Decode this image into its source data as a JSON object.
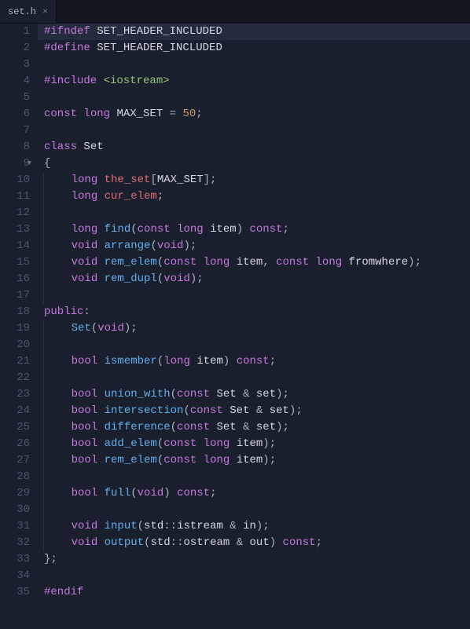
{
  "tab": {
    "filename": "set.h",
    "close": "×"
  },
  "lines": [
    {
      "n": "1",
      "fold": "",
      "hl": true,
      "tokens": [
        {
          "t": "#ifndef",
          "c": "kw"
        },
        {
          "t": " ",
          "c": ""
        },
        {
          "t": "SET_HEADER_INCLUDED",
          "c": "white"
        }
      ]
    },
    {
      "n": "2",
      "fold": "",
      "tokens": [
        {
          "t": "#define",
          "c": "kw"
        },
        {
          "t": " ",
          "c": ""
        },
        {
          "t": "SET_HEADER_INCLUDED",
          "c": "white"
        }
      ]
    },
    {
      "n": "3",
      "fold": "",
      "tokens": []
    },
    {
      "n": "4",
      "fold": "",
      "tokens": [
        {
          "t": "#include",
          "c": "kw"
        },
        {
          "t": " ",
          "c": ""
        },
        {
          "t": "<iostream>",
          "c": "str"
        }
      ]
    },
    {
      "n": "5",
      "fold": "",
      "tokens": []
    },
    {
      "n": "6",
      "fold": "",
      "tokens": [
        {
          "t": "const",
          "c": "kw"
        },
        {
          "t": " ",
          "c": ""
        },
        {
          "t": "long",
          "c": "type"
        },
        {
          "t": " ",
          "c": ""
        },
        {
          "t": "MAX_SET",
          "c": "white"
        },
        {
          "t": " = ",
          "c": "grey"
        },
        {
          "t": "50",
          "c": "num"
        },
        {
          "t": ";",
          "c": "grey"
        }
      ]
    },
    {
      "n": "7",
      "fold": "",
      "tokens": []
    },
    {
      "n": "8",
      "fold": "",
      "tokens": [
        {
          "t": "class",
          "c": "kw"
        },
        {
          "t": " ",
          "c": ""
        },
        {
          "t": "Set",
          "c": "white"
        }
      ]
    },
    {
      "n": "9",
      "fold": "▼",
      "tokens": [
        {
          "t": "{",
          "c": "grey"
        }
      ]
    },
    {
      "n": "10",
      "fold": "",
      "indent": 1,
      "tokens": [
        {
          "t": "    ",
          "c": ""
        },
        {
          "t": "long",
          "c": "type"
        },
        {
          "t": " ",
          "c": ""
        },
        {
          "t": "the_set",
          "c": "ident"
        },
        {
          "t": "[",
          "c": "grey"
        },
        {
          "t": "MAX_SET",
          "c": "white"
        },
        {
          "t": "];",
          "c": "grey"
        }
      ]
    },
    {
      "n": "11",
      "fold": "",
      "indent": 1,
      "tokens": [
        {
          "t": "    ",
          "c": ""
        },
        {
          "t": "long",
          "c": "type"
        },
        {
          "t": " ",
          "c": ""
        },
        {
          "t": "cur_elem",
          "c": "ident"
        },
        {
          "t": ";",
          "c": "grey"
        }
      ]
    },
    {
      "n": "12",
      "fold": "",
      "indent": 1,
      "tokens": []
    },
    {
      "n": "13",
      "fold": "",
      "indent": 1,
      "tokens": [
        {
          "t": "    ",
          "c": ""
        },
        {
          "t": "long",
          "c": "type"
        },
        {
          "t": " ",
          "c": ""
        },
        {
          "t": "find",
          "c": "func"
        },
        {
          "t": "(",
          "c": "grey"
        },
        {
          "t": "const",
          "c": "kw"
        },
        {
          "t": " ",
          "c": ""
        },
        {
          "t": "long",
          "c": "type"
        },
        {
          "t": " ",
          "c": ""
        },
        {
          "t": "item",
          "c": "white"
        },
        {
          "t": ") ",
          "c": "grey"
        },
        {
          "t": "const",
          "c": "kw"
        },
        {
          "t": ";",
          "c": "grey"
        }
      ]
    },
    {
      "n": "14",
      "fold": "",
      "indent": 1,
      "tokens": [
        {
          "t": "    ",
          "c": ""
        },
        {
          "t": "void",
          "c": "type"
        },
        {
          "t": " ",
          "c": ""
        },
        {
          "t": "arrange",
          "c": "func"
        },
        {
          "t": "(",
          "c": "grey"
        },
        {
          "t": "void",
          "c": "type"
        },
        {
          "t": ");",
          "c": "grey"
        }
      ]
    },
    {
      "n": "15",
      "fold": "",
      "indent": 1,
      "tokens": [
        {
          "t": "    ",
          "c": ""
        },
        {
          "t": "void",
          "c": "type"
        },
        {
          "t": " ",
          "c": ""
        },
        {
          "t": "rem_elem",
          "c": "func"
        },
        {
          "t": "(",
          "c": "grey"
        },
        {
          "t": "const",
          "c": "kw"
        },
        {
          "t": " ",
          "c": ""
        },
        {
          "t": "long",
          "c": "type"
        },
        {
          "t": " ",
          "c": ""
        },
        {
          "t": "item",
          "c": "white"
        },
        {
          "t": ", ",
          "c": "grey"
        },
        {
          "t": "const",
          "c": "kw"
        },
        {
          "t": " ",
          "c": ""
        },
        {
          "t": "long",
          "c": "type"
        },
        {
          "t": " ",
          "c": ""
        },
        {
          "t": "fromwhere",
          "c": "white"
        },
        {
          "t": ");",
          "c": "grey"
        }
      ]
    },
    {
      "n": "16",
      "fold": "",
      "indent": 1,
      "tokens": [
        {
          "t": "    ",
          "c": ""
        },
        {
          "t": "void",
          "c": "type"
        },
        {
          "t": " ",
          "c": ""
        },
        {
          "t": "rem_dupl",
          "c": "func"
        },
        {
          "t": "(",
          "c": "grey"
        },
        {
          "t": "void",
          "c": "type"
        },
        {
          "t": ");",
          "c": "grey"
        }
      ]
    },
    {
      "n": "17",
      "fold": "",
      "indent": 1,
      "tokens": []
    },
    {
      "n": "18",
      "fold": "",
      "tokens": [
        {
          "t": "public",
          "c": "kw"
        },
        {
          "t": ":",
          "c": "grey"
        }
      ]
    },
    {
      "n": "19",
      "fold": "",
      "indent": 1,
      "tokens": [
        {
          "t": "    ",
          "c": ""
        },
        {
          "t": "Set",
          "c": "func"
        },
        {
          "t": "(",
          "c": "grey"
        },
        {
          "t": "void",
          "c": "type"
        },
        {
          "t": ");",
          "c": "grey"
        }
      ]
    },
    {
      "n": "20",
      "fold": "",
      "indent": 1,
      "tokens": []
    },
    {
      "n": "21",
      "fold": "",
      "indent": 1,
      "tokens": [
        {
          "t": "    ",
          "c": ""
        },
        {
          "t": "bool",
          "c": "type"
        },
        {
          "t": " ",
          "c": ""
        },
        {
          "t": "ismember",
          "c": "func"
        },
        {
          "t": "(",
          "c": "grey"
        },
        {
          "t": "long",
          "c": "type"
        },
        {
          "t": " ",
          "c": ""
        },
        {
          "t": "item",
          "c": "white"
        },
        {
          "t": ") ",
          "c": "grey"
        },
        {
          "t": "const",
          "c": "kw"
        },
        {
          "t": ";",
          "c": "grey"
        }
      ]
    },
    {
      "n": "22",
      "fold": "",
      "indent": 1,
      "tokens": []
    },
    {
      "n": "23",
      "fold": "",
      "indent": 1,
      "tokens": [
        {
          "t": "    ",
          "c": ""
        },
        {
          "t": "bool",
          "c": "type"
        },
        {
          "t": " ",
          "c": ""
        },
        {
          "t": "union_with",
          "c": "func"
        },
        {
          "t": "(",
          "c": "grey"
        },
        {
          "t": "const",
          "c": "kw"
        },
        {
          "t": " ",
          "c": ""
        },
        {
          "t": "Set",
          "c": "white"
        },
        {
          "t": " & ",
          "c": "grey"
        },
        {
          "t": "set",
          "c": "white"
        },
        {
          "t": ");",
          "c": "grey"
        }
      ]
    },
    {
      "n": "24",
      "fold": "",
      "indent": 1,
      "tokens": [
        {
          "t": "    ",
          "c": ""
        },
        {
          "t": "bool",
          "c": "type"
        },
        {
          "t": " ",
          "c": ""
        },
        {
          "t": "intersection",
          "c": "func"
        },
        {
          "t": "(",
          "c": "grey"
        },
        {
          "t": "const",
          "c": "kw"
        },
        {
          "t": " ",
          "c": ""
        },
        {
          "t": "Set",
          "c": "white"
        },
        {
          "t": " & ",
          "c": "grey"
        },
        {
          "t": "set",
          "c": "white"
        },
        {
          "t": ");",
          "c": "grey"
        }
      ]
    },
    {
      "n": "25",
      "fold": "",
      "indent": 1,
      "tokens": [
        {
          "t": "    ",
          "c": ""
        },
        {
          "t": "bool",
          "c": "type"
        },
        {
          "t": " ",
          "c": ""
        },
        {
          "t": "difference",
          "c": "func"
        },
        {
          "t": "(",
          "c": "grey"
        },
        {
          "t": "const",
          "c": "kw"
        },
        {
          "t": " ",
          "c": ""
        },
        {
          "t": "Set",
          "c": "white"
        },
        {
          "t": " & ",
          "c": "grey"
        },
        {
          "t": "set",
          "c": "white"
        },
        {
          "t": ");",
          "c": "grey"
        }
      ]
    },
    {
      "n": "26",
      "fold": "",
      "indent": 1,
      "tokens": [
        {
          "t": "    ",
          "c": ""
        },
        {
          "t": "bool",
          "c": "type"
        },
        {
          "t": " ",
          "c": ""
        },
        {
          "t": "add_elem",
          "c": "func"
        },
        {
          "t": "(",
          "c": "grey"
        },
        {
          "t": "const",
          "c": "kw"
        },
        {
          "t": " ",
          "c": ""
        },
        {
          "t": "long",
          "c": "type"
        },
        {
          "t": " ",
          "c": ""
        },
        {
          "t": "item",
          "c": "white"
        },
        {
          "t": ");",
          "c": "grey"
        }
      ]
    },
    {
      "n": "27",
      "fold": "",
      "indent": 1,
      "tokens": [
        {
          "t": "    ",
          "c": ""
        },
        {
          "t": "bool",
          "c": "type"
        },
        {
          "t": " ",
          "c": ""
        },
        {
          "t": "rem_elem",
          "c": "func"
        },
        {
          "t": "(",
          "c": "grey"
        },
        {
          "t": "const",
          "c": "kw"
        },
        {
          "t": " ",
          "c": ""
        },
        {
          "t": "long",
          "c": "type"
        },
        {
          "t": " ",
          "c": ""
        },
        {
          "t": "item",
          "c": "white"
        },
        {
          "t": ");",
          "c": "grey"
        }
      ]
    },
    {
      "n": "28",
      "fold": "",
      "indent": 1,
      "tokens": []
    },
    {
      "n": "29",
      "fold": "",
      "indent": 1,
      "tokens": [
        {
          "t": "    ",
          "c": ""
        },
        {
          "t": "bool",
          "c": "type"
        },
        {
          "t": " ",
          "c": ""
        },
        {
          "t": "full",
          "c": "func"
        },
        {
          "t": "(",
          "c": "grey"
        },
        {
          "t": "void",
          "c": "type"
        },
        {
          "t": ") ",
          "c": "grey"
        },
        {
          "t": "const",
          "c": "kw"
        },
        {
          "t": ";",
          "c": "grey"
        }
      ]
    },
    {
      "n": "30",
      "fold": "",
      "indent": 1,
      "tokens": []
    },
    {
      "n": "31",
      "fold": "",
      "indent": 1,
      "tokens": [
        {
          "t": "    ",
          "c": ""
        },
        {
          "t": "void",
          "c": "type"
        },
        {
          "t": " ",
          "c": ""
        },
        {
          "t": "input",
          "c": "func"
        },
        {
          "t": "(",
          "c": "grey"
        },
        {
          "t": "std",
          "c": "white"
        },
        {
          "t": "::",
          "c": "grey"
        },
        {
          "t": "istream",
          "c": "white"
        },
        {
          "t": " & ",
          "c": "grey"
        },
        {
          "t": "in",
          "c": "white"
        },
        {
          "t": ");",
          "c": "grey"
        }
      ]
    },
    {
      "n": "32",
      "fold": "",
      "indent": 1,
      "tokens": [
        {
          "t": "    ",
          "c": ""
        },
        {
          "t": "void",
          "c": "type"
        },
        {
          "t": " ",
          "c": ""
        },
        {
          "t": "output",
          "c": "func"
        },
        {
          "t": "(",
          "c": "grey"
        },
        {
          "t": "std",
          "c": "white"
        },
        {
          "t": "::",
          "c": "grey"
        },
        {
          "t": "ostream",
          "c": "white"
        },
        {
          "t": " & ",
          "c": "grey"
        },
        {
          "t": "out",
          "c": "white"
        },
        {
          "t": ") ",
          "c": "grey"
        },
        {
          "t": "const",
          "c": "kw"
        },
        {
          "t": ";",
          "c": "grey"
        }
      ]
    },
    {
      "n": "33",
      "fold": "",
      "tokens": [
        {
          "t": "};",
          "c": "grey"
        }
      ]
    },
    {
      "n": "34",
      "fold": "",
      "tokens": []
    },
    {
      "n": "35",
      "fold": "",
      "tokens": [
        {
          "t": "#endif",
          "c": "kw"
        }
      ]
    }
  ]
}
